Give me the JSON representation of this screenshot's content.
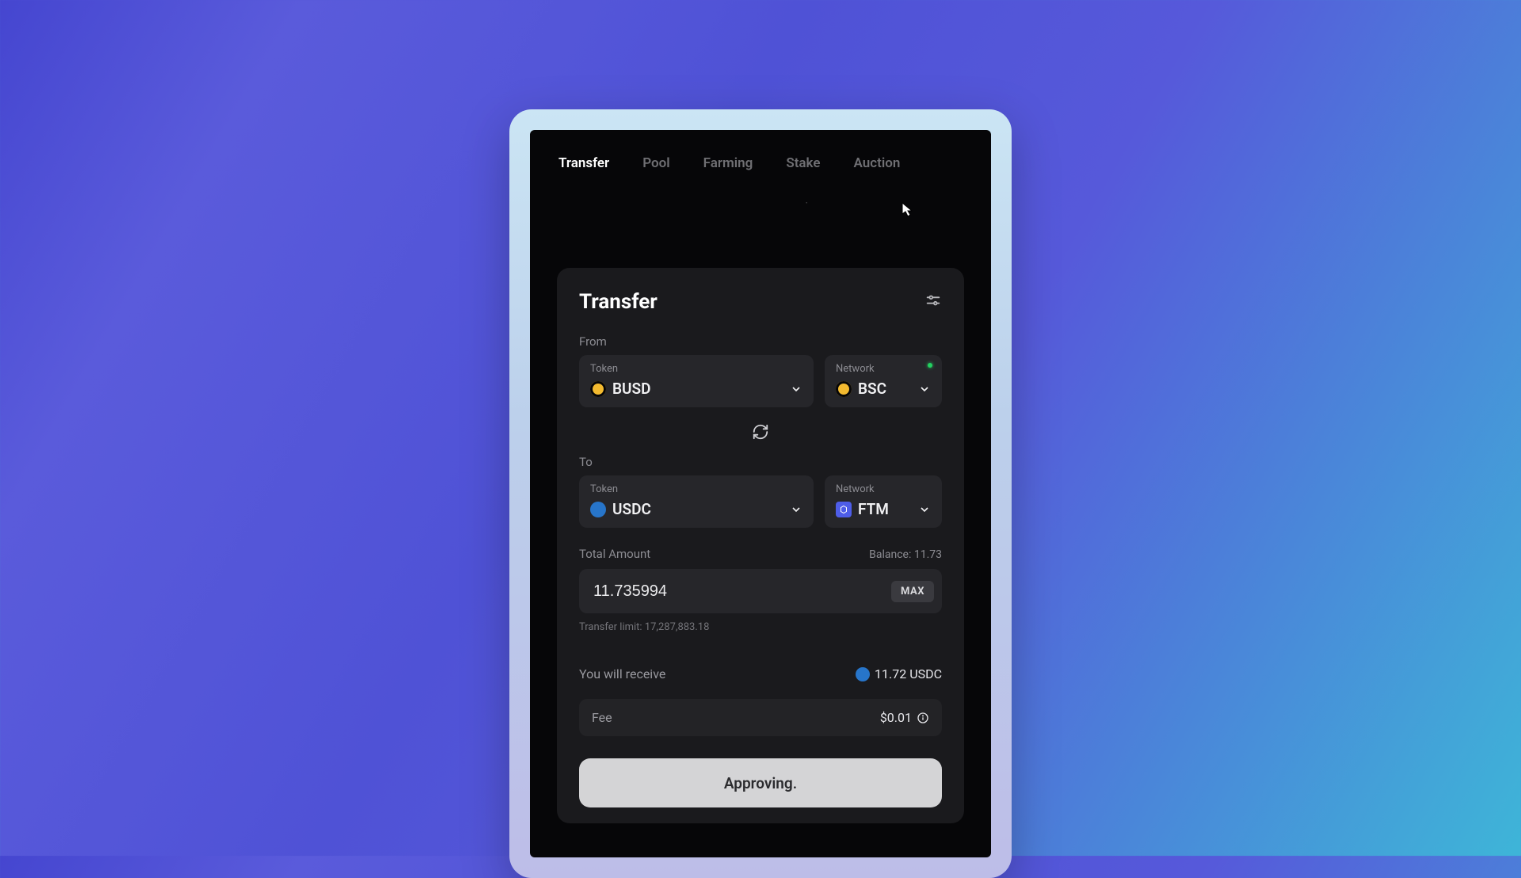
{
  "tabs": {
    "t0": "Transfer",
    "t1": "Pool",
    "t2": "Farming",
    "t3": "Stake",
    "t4": "Auction"
  },
  "card": {
    "title": "Transfer",
    "from_label": "From",
    "to_label": "To",
    "token_label": "Token",
    "network_label": "Network",
    "from_token": "BUSD",
    "from_network": "BSC",
    "to_token": "USDC",
    "to_network": "FTM",
    "amount_label": "Total Amount",
    "balance_label": "Balance: 11.73",
    "amount_value": "11.735994",
    "max_label": "MAX",
    "limit_label": "Transfer limit: 17,287,883.18",
    "receive_label": "You will receive",
    "receive_value": "11.72 USDC",
    "fee_label": "Fee",
    "fee_value": "$0.01",
    "button": "Approving."
  }
}
